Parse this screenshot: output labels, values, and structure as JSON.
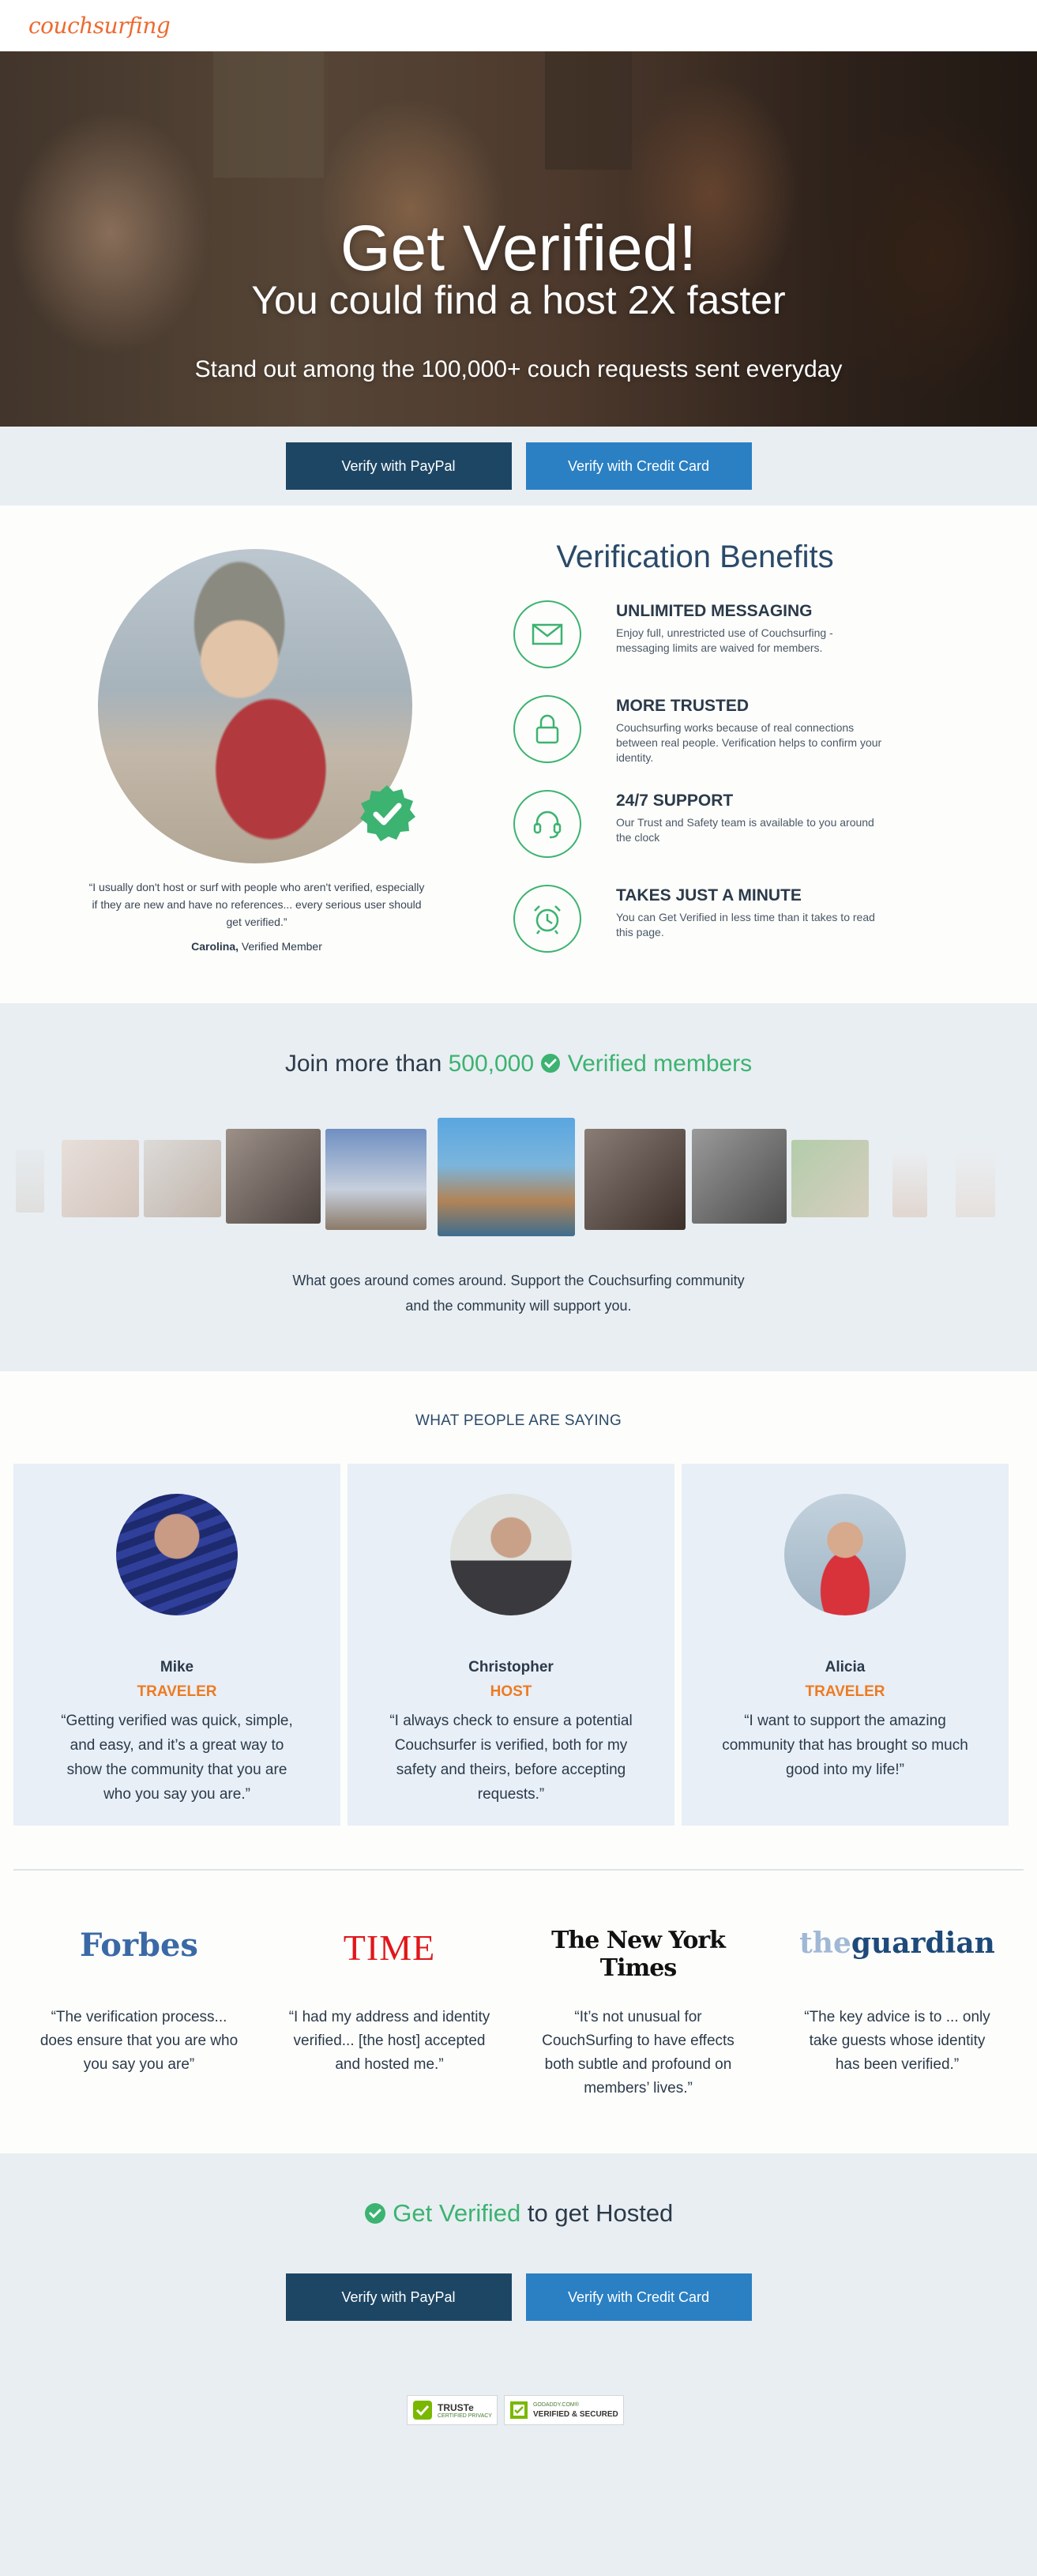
{
  "header": {
    "logo": "couchsurfing"
  },
  "hero": {
    "title": "Get Verified!",
    "subtitle": "You could find a host 2X faster",
    "tagline": "Stand out among the 100,000+ couch requests sent everyday"
  },
  "verify_buttons": {
    "paypal": "Verify with PayPal",
    "credit_card": "Verify with Credit Card"
  },
  "benefits": {
    "title": "Verification Benefits",
    "quote": "“I usually don't host or surf with people who aren't verified, especially if they are new and have no references... every serious user should get verified.”",
    "quote_name": "Carolina,",
    "quote_role": "Verified Member",
    "items": [
      {
        "icon": "envelope-icon",
        "heading": "UNLIMITED MESSAGING",
        "text": "Enjoy full, unrestricted use of Couchsurfing - messaging limits are waived for members."
      },
      {
        "icon": "lock-icon",
        "heading": "MORE TRUSTED",
        "text": "Couchsurfing works because of real connections between real people. Verification helps to confirm your identity."
      },
      {
        "icon": "headset-icon",
        "heading": "24/7 SUPPORT",
        "text": "Our Trust and Safety team is available to you around the clock"
      },
      {
        "icon": "alarm-clock-icon",
        "heading": "TAKES JUST A MINUTE",
        "text": "You can Get Verified in less time than it takes to read this page."
      }
    ],
    "accent": "#3cb371"
  },
  "members": {
    "join_prefix": "Join more than",
    "count": "500,000",
    "verified_label": "Verified members",
    "text_line1": "What goes around comes around. Support the Couchsurfing community",
    "text_line2": "and the community will support you."
  },
  "testimonials": {
    "title": "WHAT PEOPLE ARE SAYING",
    "cards": [
      {
        "name": "Mike",
        "role": "TRAVELER",
        "quote": "“Getting verified was quick, simple, and easy, and it’s a great way to show the community that you are who you say you are.”"
      },
      {
        "name": "Christopher",
        "role": "HOST",
        "quote": "“I always check to ensure a potential Couchsurfer is verified, both for my safety and theirs, before accepting requests.”"
      },
      {
        "name": "Alicia",
        "role": "TRAVELER",
        "quote": "“I want to support the amazing community that has brought so much good into my life!”"
      }
    ]
  },
  "press": [
    {
      "logo": "Forbes",
      "quote": "“The verification process... does ensure that you are who you say you are”"
    },
    {
      "logo": "TIME",
      "quote": "“I had my address and identity verified... [the host] accepted and hosted me.”"
    },
    {
      "logo": "The New York Times",
      "quote": "“It’s not unusual for CouchSurfing to have effects both subtle and profound on members’ lives.”"
    },
    {
      "logo_part1": "the",
      "logo_part2": "guardian",
      "quote": "“The key advice is to ... only take guests whose identity has been verified.”"
    }
  ],
  "cta": {
    "green": "Get Verified",
    "rest": "to get Hosted",
    "paypal": "Verify with PayPal",
    "credit_card": "Verify with Credit Card"
  },
  "trust_badges": {
    "truste": "TRUSTe",
    "truste_sub": "CERTIFIED PRIVACY",
    "godaddy_sub": "GODADDY.COM®",
    "godaddy": "VERIFIED & SECURED"
  },
  "colors": {
    "orange": "#ed7b22",
    "green": "#3cb371",
    "navy": "#1d4664",
    "blue": "#2b80c3"
  }
}
